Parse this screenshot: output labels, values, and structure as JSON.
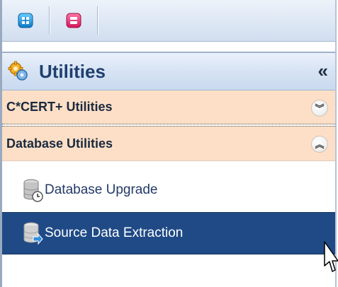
{
  "toolbar": {
    "buttons": [
      {
        "icon": "expand-all-icon"
      },
      {
        "icon": "collapse-all-icon"
      }
    ]
  },
  "header": {
    "title": "Utilities",
    "collapse_glyph": "«",
    "icon": "gears-icon"
  },
  "sections": [
    {
      "label": "C*CERT+ Utilities",
      "toggle": "︾",
      "expanded": false
    },
    {
      "label": "Database Utilities",
      "toggle": "︽",
      "expanded": true
    }
  ],
  "items": [
    {
      "label": "Database Upgrade",
      "icon": "database-clock-icon",
      "selected": false
    },
    {
      "label": "Source Data Extraction",
      "icon": "database-export-icon",
      "selected": true
    }
  ],
  "colors": {
    "accent": "#1f4a86",
    "section_bg": "#fcdfc6",
    "header_text": "#1f3f6e"
  }
}
